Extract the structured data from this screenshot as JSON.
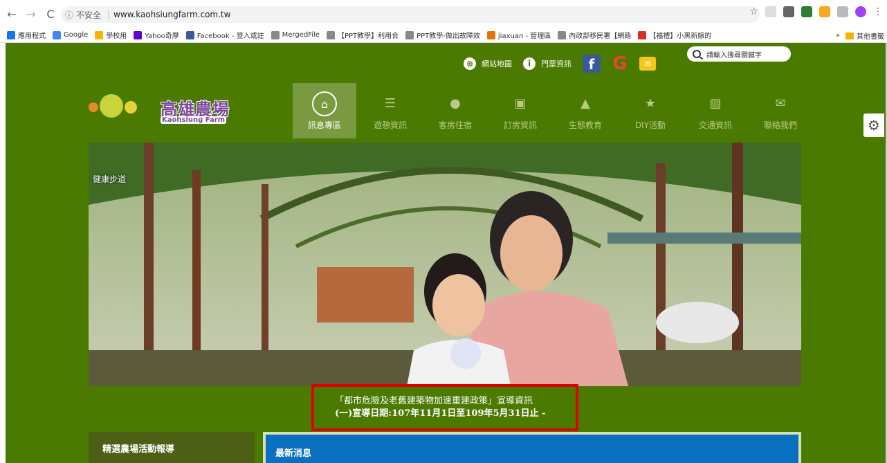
{
  "browser": {
    "nav": {
      "back": "←",
      "forward": "→",
      "reload": "C"
    },
    "security_label": "不安全",
    "url": "www.kaohsiungfarm.com.tw",
    "star": "☆",
    "more": "⋮"
  },
  "bookmarks": {
    "items": [
      {
        "label": "應用程式",
        "color": "#1a73e8"
      },
      {
        "label": "Google",
        "color": "#4285f4"
      },
      {
        "label": "學校用",
        "color": "#f4b400"
      },
      {
        "label": "Yahoo奇摩",
        "color": "#6001d2"
      },
      {
        "label": "Facebook - 登入或註",
        "color": "#3b5998"
      },
      {
        "label": "MergedFile",
        "color": "#888888"
      },
      {
        "label": "【PPT教學】利用合",
        "color": "#888888"
      },
      {
        "label": "PPT教學-做出故障效",
        "color": "#888888"
      },
      {
        "label": "jiaxuan - 管理區",
        "color": "#e37400"
      },
      {
        "label": "內政部移民署【網路",
        "color": "#888888"
      },
      {
        "label": "【福禮】小黑新娘的",
        "color": "#d93025"
      }
    ],
    "overflow": "»",
    "other": "其他書籤"
  },
  "site": {
    "topbar": {
      "sitemap": "網站地圖",
      "tickets": "門票資訊",
      "search_placeholder": "請輸入搜尋關鍵字"
    },
    "logo": {
      "title": "高雄農場",
      "subtitle": "Kaohsiung Farm"
    },
    "menu": [
      {
        "label": "訊息專區",
        "icon": "⌂"
      },
      {
        "label": "遊憩資訊",
        "icon": "☰"
      },
      {
        "label": "客房住宿",
        "icon": "●"
      },
      {
        "label": "訂房資訊",
        "icon": "▣"
      },
      {
        "label": "生態教育",
        "icon": "▲"
      },
      {
        "label": "DIY活動",
        "icon": "★"
      },
      {
        "label": "交通資訊",
        "icon": "▨"
      },
      {
        "label": "聯絡我們",
        "icon": "✉"
      }
    ],
    "hero_caption": "健康步道",
    "notice": {
      "line1": "「都市危險及老舊建築物加速重建政策」宣導資訊",
      "line2": "(一)宣導日期:107年11月1日至109年5月31日止 -"
    },
    "left_panel_title": "精選農場活動報導",
    "right_panel_title": "最新消息"
  }
}
